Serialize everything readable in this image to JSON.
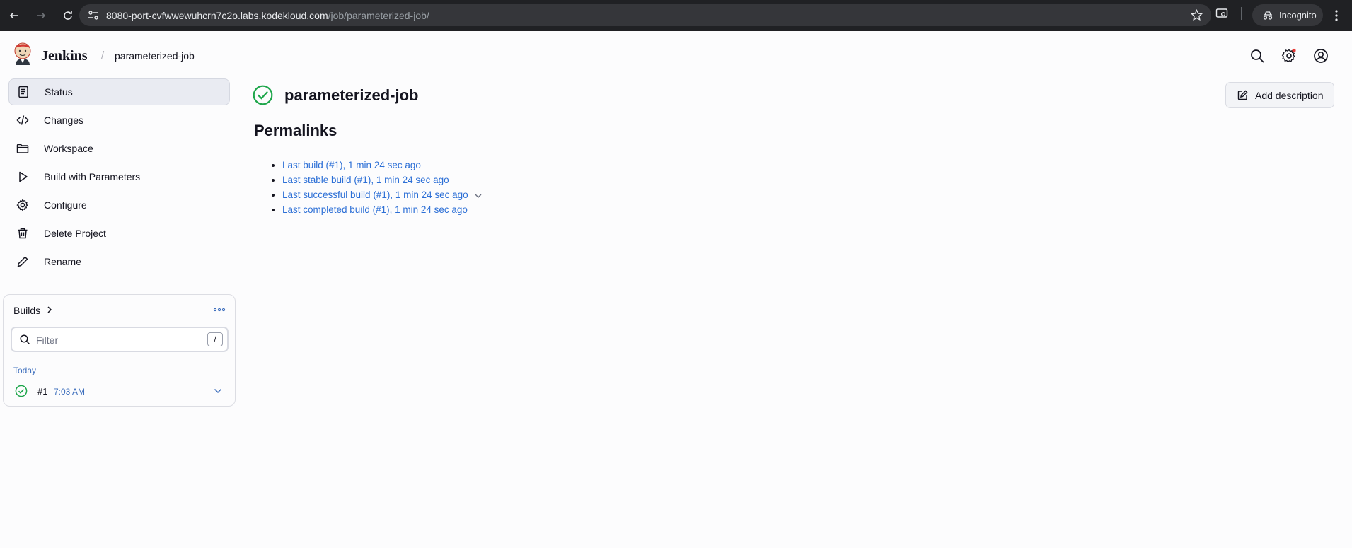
{
  "browser": {
    "url_host": "8080-port-cvfwwewuhcrn7c2o.labs.kodekloud.com",
    "url_path": "/job/parameterized-job/",
    "profile_label": "Incognito"
  },
  "header": {
    "brand": "Jenkins",
    "breadcrumb_separator": "/",
    "breadcrumb_job": "parameterized-job"
  },
  "sidebar": {
    "items": [
      {
        "label": "Status",
        "icon": "status-icon"
      },
      {
        "label": "Changes",
        "icon": "code-icon"
      },
      {
        "label": "Workspace",
        "icon": "folder-icon"
      },
      {
        "label": "Build with Parameters",
        "icon": "play-icon"
      },
      {
        "label": "Configure",
        "icon": "gear-icon"
      },
      {
        "label": "Delete Project",
        "icon": "trash-icon"
      },
      {
        "label": "Rename",
        "icon": "pencil-icon"
      }
    ]
  },
  "builds": {
    "title": "Builds",
    "filter_placeholder": "Filter",
    "filter_shortcut": "/",
    "group_label": "Today",
    "items": [
      {
        "number": "#1",
        "time": "7:03 AM",
        "status": "success"
      }
    ]
  },
  "main": {
    "job_title": "parameterized-job",
    "add_description_label": "Add description",
    "permalinks_title": "Permalinks",
    "permalinks": [
      "Last build (#1), 1 min 24 sec ago",
      "Last stable build (#1), 1 min 24 sec ago",
      "Last successful build (#1), 1 min 24 sec ago",
      "Last completed build (#1), 1 min 24 sec ago"
    ]
  },
  "colors": {
    "success": "#1ea64b",
    "link": "#2c6fd6",
    "chrome_bg": "#202124"
  }
}
